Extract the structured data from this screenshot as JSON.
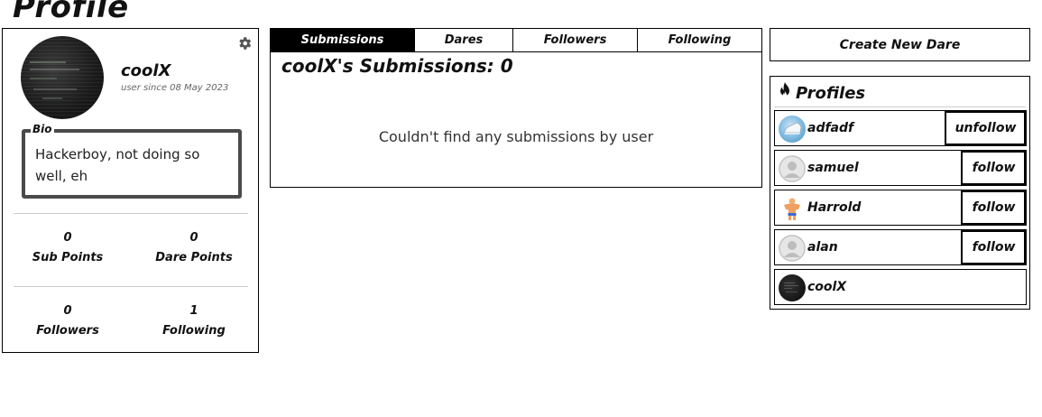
{
  "page": {
    "title": "Profile"
  },
  "profile": {
    "username": "coolX",
    "user_since": "user since 08 May 2023",
    "bio_label": "Bio",
    "bio": "Hackerboy, not doing so well, eh",
    "stats": {
      "sub_points": {
        "value": "0",
        "label": "Sub Points"
      },
      "dare_points": {
        "value": "0",
        "label": "Dare Points"
      },
      "followers": {
        "value": "0",
        "label": "Followers"
      },
      "following": {
        "value": "1",
        "label": "Following"
      }
    },
    "settings_icon": "gear-icon"
  },
  "tabs": [
    {
      "label": "Submissions",
      "active": true
    },
    {
      "label": "Dares",
      "active": false
    },
    {
      "label": "Followers",
      "active": false
    },
    {
      "label": "Following",
      "active": false
    }
  ],
  "main": {
    "heading": "coolX's Submissions: 0",
    "empty_message": "Couldn't find any submissions by user"
  },
  "sidebar": {
    "create_button": "Create New Dare",
    "profiles_heading": "Profiles",
    "profiles_icon": "flame-icon",
    "profiles": [
      {
        "name": "adfadf",
        "button": "unfollow",
        "avatar": "shoe-avatar"
      },
      {
        "name": "samuel",
        "button": "follow",
        "avatar": "default-avatar"
      },
      {
        "name": "Harrold",
        "button": "follow",
        "avatar": "bodybuilder-avatar"
      },
      {
        "name": "alan",
        "button": "follow",
        "avatar": "default-avatar"
      },
      {
        "name": "coolX",
        "button": "",
        "avatar": "dark-avatar"
      }
    ]
  },
  "colors": {
    "active_tab_bg": "#000000",
    "active_tab_text": "#ffffff",
    "border": "#000000",
    "bio_border": "#4a4a4a",
    "muted_text": "#666666"
  }
}
